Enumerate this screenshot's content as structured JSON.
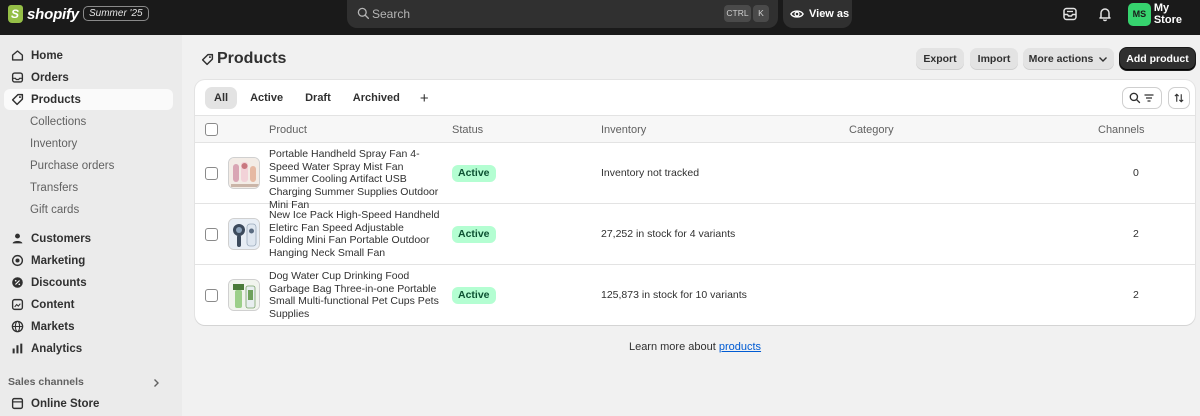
{
  "topbar": {
    "logo_text": "shopify",
    "season_badge": "Summer '25",
    "search_placeholder": "Search",
    "shortcut_ctrl": "CTRL",
    "shortcut_key": "K",
    "view_as_label": "View as",
    "store_initials": "MS",
    "store_name": "My Store"
  },
  "sidebar": {
    "items": [
      {
        "label": "Home",
        "icon": "home-icon"
      },
      {
        "label": "Orders",
        "icon": "inbox-icon"
      },
      {
        "label": "Products",
        "icon": "tag-icon",
        "active": true
      },
      {
        "label": "Customers",
        "icon": "person-icon"
      },
      {
        "label": "Marketing",
        "icon": "target-icon"
      },
      {
        "label": "Discounts",
        "icon": "discount-icon"
      },
      {
        "label": "Content",
        "icon": "content-icon"
      },
      {
        "label": "Markets",
        "icon": "globe-icon"
      },
      {
        "label": "Analytics",
        "icon": "chart-icon"
      }
    ],
    "sub_items": [
      "Collections",
      "Inventory",
      "Purchase orders",
      "Transfers",
      "Gift cards"
    ],
    "sales_channels_label": "Sales channels",
    "channel_items": [
      {
        "label": "Online Store",
        "icon": "store-icon"
      }
    ]
  },
  "page": {
    "title": "Products",
    "export_label": "Export",
    "import_label": "Import",
    "more_actions_label": "More actions",
    "add_product_label": "Add product"
  },
  "tabs": [
    "All",
    "Active",
    "Draft",
    "Archived"
  ],
  "table": {
    "headers": {
      "product": "Product",
      "status": "Status",
      "inventory": "Inventory",
      "category": "Category",
      "channels": "Channels"
    },
    "rows": [
      {
        "name": "Portable Handheld Spray Fan 4-Speed Water Spray Mist Fan Summer Cooling Artifact USB Charging Summer Supplies Outdoor Mini Fan",
        "status": "Active",
        "inventory": "Inventory not tracked",
        "category": "",
        "channels": "0"
      },
      {
        "name": "New Ice Pack High-Speed Handheld Eletirc Fan Speed Adjustable Folding Mini Fan Portable Outdoor Hanging Neck Small Fan",
        "status": "Active",
        "inventory": "27,252 in stock for 4 variants",
        "category": "",
        "channels": "2"
      },
      {
        "name": "Dog Water Cup Drinking Food Garbage Bag Three-in-one Portable Small Multi-functional Pet Cups Pets Supplies",
        "status": "Active",
        "inventory": "125,873 in stock for 10 variants",
        "category": "",
        "channels": "2"
      }
    ]
  },
  "footer": {
    "learn_prefix": "Learn more about ",
    "learn_link": "products"
  },
  "colors": {
    "topbar_bg": "#1a1a1a",
    "brand_green": "#95bf47",
    "active_badge_bg": "#b4fed2",
    "active_badge_text": "#0c5132",
    "link": "#005bd3",
    "avatar_bg": "#36d36e"
  }
}
